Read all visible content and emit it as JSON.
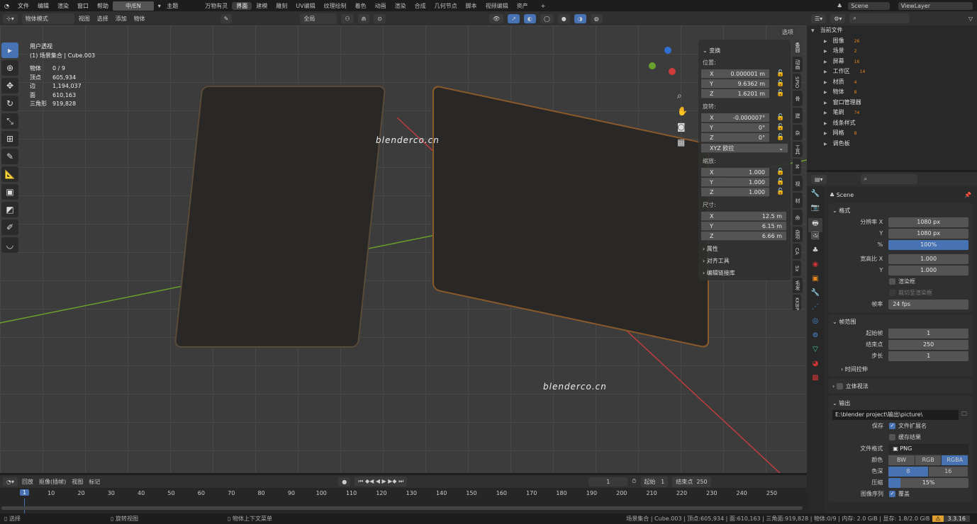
{
  "topbar": {
    "menus": [
      "文件",
      "编辑",
      "渲染",
      "窗口",
      "帮助"
    ],
    "lang": "中/EN",
    "theme": "主题",
    "workspaces": [
      "万物有灵",
      "界面",
      "建模",
      "雕刻",
      "UV编辑",
      "纹理绘制",
      "着色",
      "动画",
      "渲染",
      "合成",
      "几何节点",
      "脚本",
      "视频编辑",
      "资产"
    ],
    "active_workspace": "界面",
    "scene": "Scene",
    "view_layer": "ViewLayer"
  },
  "viewport_header": {
    "mode": "物体模式",
    "menus": [
      "视图",
      "选择",
      "添加",
      "物体"
    ],
    "transform_orientation": "全局",
    "options": "选项"
  },
  "overlay": {
    "view_name": "用户透视",
    "collection": "(1) 场景集合 | Cube.003",
    "stats": [
      {
        "k": "物体",
        "v": "0 / 9"
      },
      {
        "k": "顶点",
        "v": "605,934"
      },
      {
        "k": "边",
        "v": "1,194,037"
      },
      {
        "k": "面",
        "v": "610,163"
      },
      {
        "k": "三角形",
        "v": "919,828"
      }
    ],
    "watermark": "blenderco.cn"
  },
  "npanel": {
    "title": "变换",
    "location_label": "位置:",
    "location": [
      {
        "axis": "X",
        "v": "0.000001 m"
      },
      {
        "axis": "Y",
        "v": "9.6362 m"
      },
      {
        "axis": "Z",
        "v": "1.6201 m"
      }
    ],
    "rotation_label": "旋转:",
    "rotation": [
      {
        "axis": "X",
        "v": "-0.000007°"
      },
      {
        "axis": "Y",
        "v": "0°"
      },
      {
        "axis": "Z",
        "v": "0°"
      }
    ],
    "rotation_mode": "XYZ 欧拉",
    "scale_label": "缩放:",
    "scale": [
      {
        "axis": "X",
        "v": "1.000"
      },
      {
        "axis": "Y",
        "v": "1.000"
      },
      {
        "axis": "Z",
        "v": "1.000"
      }
    ],
    "dimensions_label": "尺寸:",
    "dimensions": [
      {
        "axis": "X",
        "v": "12.5 m"
      },
      {
        "axis": "Y",
        "v": "6.15 m"
      },
      {
        "axis": "Z",
        "v": "6.66 m"
      }
    ],
    "collapsed": [
      "属性",
      "对齐工具",
      "编辑链接库"
    ],
    "tabs": [
      "条目",
      "动画",
      "SPIO",
      "骨",
      "建",
      "杂",
      "工具",
      "M",
      "视",
      "材",
      "命",
      "杂项",
      "CA",
      "Sx",
      "毛发",
      "KKBP"
    ]
  },
  "outliner": {
    "root": "当前文件",
    "items": [
      {
        "label": "图像",
        "count": "26"
      },
      {
        "label": "场景",
        "count": "2"
      },
      {
        "label": "屏幕",
        "count": "16"
      },
      {
        "label": "工作区",
        "count": "14"
      },
      {
        "label": "材质",
        "count": "4"
      },
      {
        "label": "物体",
        "count": "8"
      },
      {
        "label": "窗口管理器",
        "count": ""
      },
      {
        "label": "笔刷",
        "count": "74"
      },
      {
        "label": "线条样式",
        "count": ""
      },
      {
        "label": "网格",
        "count": "8"
      },
      {
        "label": "调色板",
        "count": ""
      }
    ]
  },
  "properties": {
    "scene": "Scene",
    "format": {
      "title": "格式",
      "res_x_label": "分辨率 X",
      "res_x": "1080 px",
      "res_y_label": "Y",
      "res_y": "1080 px",
      "pct_label": "%",
      "pct": "100%",
      "aspect_x_label": "宽高比 X",
      "aspect_x": "1.000",
      "aspect_y_label": "Y",
      "aspect_y": "1.000",
      "render_region": "渲染框",
      "crop": "裁切至渲染框",
      "fps_label": "帧率",
      "fps": "24 fps"
    },
    "frame_range": {
      "title": "帧范围",
      "start_label": "起始帧",
      "start": "1",
      "end_label": "结束点",
      "end": "250",
      "step_label": "步长",
      "step": "1",
      "time_stretch": "时间拉伸"
    },
    "stereo": "立体视法",
    "output": {
      "title": "输出",
      "path": "E:\\blender project\\输出\\picture\\",
      "save_label": "保存",
      "file_ext": "文件扩展名",
      "cache": "缓存结果",
      "format_label": "文件格式",
      "format": "PNG",
      "color_label": "颜色",
      "color_opts": [
        "BW",
        "RGB",
        "RGBA"
      ],
      "color_sel": "RGBA",
      "depth_label": "色深",
      "depth_opts": [
        "8",
        "16"
      ],
      "depth_sel": "8",
      "compress_label": "压缩",
      "compress": "15%",
      "compress_value": 15,
      "seq_label": "图像序列",
      "overwrite": "覆盖"
    }
  },
  "timeline": {
    "menus": [
      "回放",
      "抠像(插帧)",
      "视图",
      "标记"
    ],
    "current": "1",
    "start_label": "起始",
    "start": "1",
    "end_label": "结束点",
    "end": "250",
    "ticks": [
      "10",
      "20",
      "30",
      "40",
      "50",
      "60",
      "70",
      "80",
      "90",
      "100",
      "110",
      "120",
      "130",
      "140",
      "150",
      "160",
      "170",
      "180",
      "190",
      "200",
      "210",
      "220",
      "230",
      "240",
      "250"
    ]
  },
  "status": {
    "select": "选择",
    "rotate": "旋转视图",
    "context": "物体上下文菜单",
    "info": "场景集合 | Cube.003 | 顶点:605,934 | 面:610,163 | 三角面:919,828 | 物体:0/9 | 内存: 2.0 GiB | 显存: 1.8/2.0 GiB",
    "version": "3.3.16"
  },
  "colors": {
    "accent": "#4772b3",
    "x_axis": "#c33c3c",
    "y_axis": "#6ba02c",
    "panel": "#303030"
  }
}
